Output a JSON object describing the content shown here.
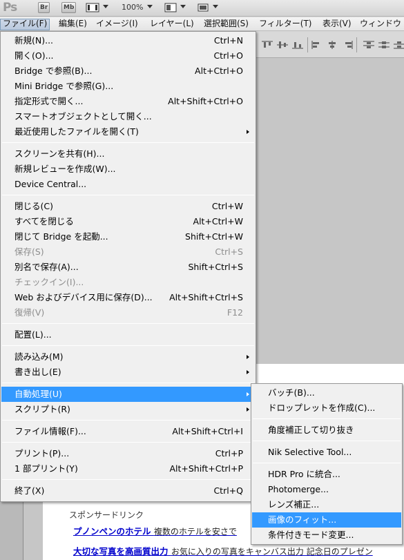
{
  "appbar": {
    "logo": "Ps",
    "bridge_label": "Br",
    "minibridge_label": "Mb",
    "zoom": "100%"
  },
  "menubar": {
    "items": [
      {
        "label": "ファイル(F)"
      },
      {
        "label": "編集(E)"
      },
      {
        "label": "イメージ(I)"
      },
      {
        "label": "レイヤー(L)"
      },
      {
        "label": "選択範囲(S)"
      },
      {
        "label": "フィルター(T)"
      },
      {
        "label": "表示(V)"
      },
      {
        "label": "ウィンドウ"
      }
    ]
  },
  "file_menu": {
    "items": [
      {
        "label": "新規(N)...",
        "shortcut": "Ctrl+N"
      },
      {
        "label": "開く(O)...",
        "shortcut": "Ctrl+O"
      },
      {
        "label": "Bridge で参照(B)...",
        "shortcut": "Alt+Ctrl+O"
      },
      {
        "label": "Mini Bridge で参照(G)...",
        "shortcut": ""
      },
      {
        "label": "指定形式で開く...",
        "shortcut": "Alt+Shift+Ctrl+O"
      },
      {
        "label": "スマートオブジェクトとして開く...",
        "shortcut": ""
      },
      {
        "label": "最近使用したファイルを開く(T)",
        "shortcut": ""
      },
      {
        "label": "スクリーンを共有(H)...",
        "shortcut": ""
      },
      {
        "label": "新規レビューを作成(W)...",
        "shortcut": ""
      },
      {
        "label": "Device Central...",
        "shortcut": ""
      },
      {
        "label": "閉じる(C)",
        "shortcut": "Ctrl+W"
      },
      {
        "label": "すべてを閉じる",
        "shortcut": "Alt+Ctrl+W"
      },
      {
        "label": "閉じて Bridge を起動...",
        "shortcut": "Shift+Ctrl+W"
      },
      {
        "label": "保存(S)",
        "shortcut": "Ctrl+S"
      },
      {
        "label": "別名で保存(A)...",
        "shortcut": "Shift+Ctrl+S"
      },
      {
        "label": "チェックイン(I)...",
        "shortcut": ""
      },
      {
        "label": "Web およびデバイス用に保存(D)...",
        "shortcut": "Alt+Shift+Ctrl+S"
      },
      {
        "label": "復帰(V)",
        "shortcut": "F12"
      },
      {
        "label": "配置(L)...",
        "shortcut": ""
      },
      {
        "label": "読み込み(M)",
        "shortcut": ""
      },
      {
        "label": "書き出し(E)",
        "shortcut": ""
      },
      {
        "label": "自動処理(U)",
        "shortcut": ""
      },
      {
        "label": "スクリプト(R)",
        "shortcut": ""
      },
      {
        "label": "ファイル情報(F)...",
        "shortcut": "Alt+Shift+Ctrl+I"
      },
      {
        "label": "プリント(P)...",
        "shortcut": "Ctrl+P"
      },
      {
        "label": "1 部プリント(Y)",
        "shortcut": "Alt+Shift+Ctrl+P"
      },
      {
        "label": "終了(X)",
        "shortcut": "Ctrl+Q"
      }
    ]
  },
  "automate_submenu": {
    "items": [
      {
        "label": "バッチ(B)..."
      },
      {
        "label": "ドロップレットを作成(C)..."
      },
      {
        "label": "角度補正して切り抜き"
      },
      {
        "label": "Nik Selective Tool..."
      },
      {
        "label": "HDR Pro に統合..."
      },
      {
        "label": "Photomerge..."
      },
      {
        "label": "レンズ補正..."
      },
      {
        "label": "画像のフィット..."
      },
      {
        "label": "条件付きモード変更..."
      }
    ]
  },
  "document": {
    "sponsor_label": "スポンサードリンク",
    "ads": [
      {
        "title": "プノンペンのホテル",
        "desc": "複数のホテルを安さで"
      },
      {
        "title": "大切な写真を高画質出力",
        "desc": "お気に入りの写真をキャンバス出力 記念日のプレゼン"
      }
    ]
  },
  "colors": {
    "highlight": "#3399ff",
    "menu_bg": "#f0f0f0",
    "disabled_text": "#8d8d8d"
  }
}
